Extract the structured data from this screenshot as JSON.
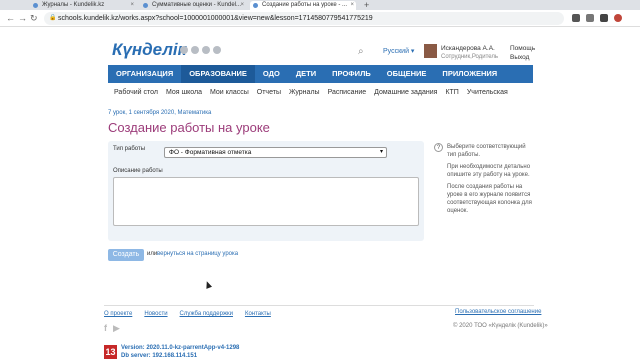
{
  "browser": {
    "tabs": [
      {
        "label": "Журналы - Kundelik.kz",
        "active": false
      },
      {
        "label": "Суммативные оценки - Kundel...",
        "active": false
      },
      {
        "label": "Создание работы на уроке - ...",
        "active": true
      }
    ],
    "url": "schools.kundelik.kz/works.aspx?school=1000001000001&view=new&lesson=1714580779541775219"
  },
  "header": {
    "logo": "Күнделік",
    "search_icon": "search-icon",
    "language": "Русский",
    "user_name": "Искандерова А.А.",
    "user_role": "Сотрудник,Родитель",
    "help": "Помощь",
    "logout": "Выход"
  },
  "main_nav": [
    "ОРГАНИЗАЦИЯ",
    "ОБРАЗОВАНИЕ",
    "ОДО",
    "ДЕТИ",
    "ПРОФИЛЬ",
    "ОБЩЕНИЕ",
    "ПРИЛОЖЕНИЯ"
  ],
  "sub_nav": [
    "Рабочий стол",
    "Моя школа",
    "Мои классы",
    "Отчеты",
    "Журналы",
    "Расписание",
    "Домашние задания",
    "КТП",
    "Учительская"
  ],
  "breadcrumb": "7 урок, 1 сентября 2020, Математика",
  "page_title": "Создание работы на уроке",
  "form": {
    "type_label": "Тип работы",
    "type_value": "ФО - Формативная отметка",
    "description_label": "Описание работы",
    "description_value": ""
  },
  "help_text": [
    "Выберите соответствующий тип работы.",
    "При необходимости детально опишите эту работу на уроке.",
    "После создания работы на уроке в его журнале появится соответствующая колонка для оценок."
  ],
  "actions": {
    "submit": "Создать",
    "or": "или",
    "back": "вернуться на страницу урока"
  },
  "footer": {
    "links": [
      "О проекте",
      "Новости",
      "Служба поддержки",
      "Контакты"
    ],
    "agreement": "Пользовательское соглашение",
    "copyright": "© 2020 ТОО «Күнделік (Kundelik)»",
    "badge": "13",
    "version": "Version: 2020.11.0-kz-parrentApp-v4-1298",
    "db_server": "Db server: 192.168.114.151"
  },
  "colors": {
    "brand": "#2a6eb3",
    "title": "#9c3c7a",
    "badge": "#c62828"
  }
}
